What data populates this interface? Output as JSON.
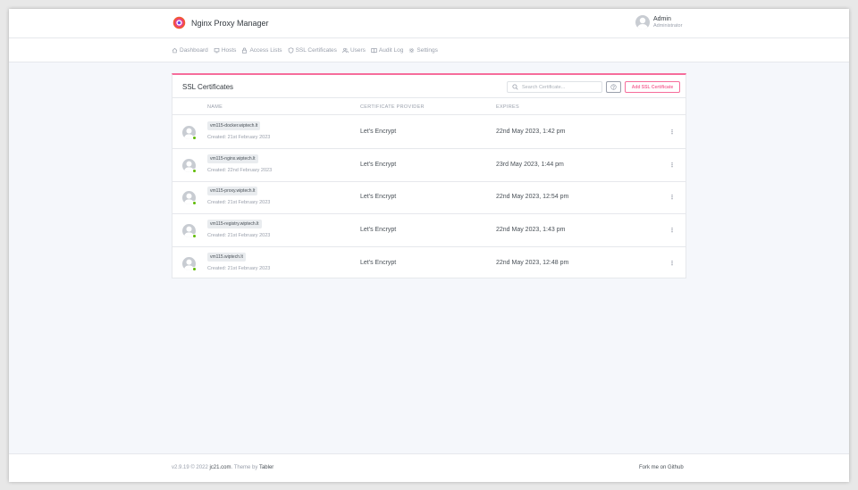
{
  "app": {
    "title": "Nginx Proxy Manager",
    "logo_icon": "nginx-proxy-manager-logo",
    "accent_color": "#f66d9b"
  },
  "user": {
    "name": "Admin",
    "role": "Administrator"
  },
  "nav": {
    "items": [
      {
        "label": "Dashboard",
        "icon": "home-icon"
      },
      {
        "label": "Hosts",
        "icon": "monitor-icon"
      },
      {
        "label": "Access Lists",
        "icon": "lock-icon"
      },
      {
        "label": "SSL Certificates",
        "icon": "shield-icon"
      },
      {
        "label": "Users",
        "icon": "users-icon"
      },
      {
        "label": "Audit Log",
        "icon": "book-icon"
      },
      {
        "label": "Settings",
        "icon": "gear-icon"
      }
    ]
  },
  "card": {
    "title": "SSL Certificates",
    "search_placeholder": "Search Certificate...",
    "add_button": "Add SSL Certificate",
    "columns": {
      "name": "NAME",
      "provider": "CERTIFICATE PROVIDER",
      "expires": "EXPIRES"
    },
    "rows": [
      {
        "domain": "vm115-docker.wiptech.lt",
        "created": "Created: 21st February 2023",
        "provider": "Let's Encrypt",
        "expires": "22nd May 2023, 1:42 pm"
      },
      {
        "domain": "vm115-nginx.wiptech.lt",
        "created": "Created: 22nd February 2023",
        "provider": "Let's Encrypt",
        "expires": "23rd May 2023, 1:44 pm"
      },
      {
        "domain": "vm115-proxy.wiptech.lt",
        "created": "Created: 21st February 2023",
        "provider": "Let's Encrypt",
        "expires": "22nd May 2023, 12:54 pm"
      },
      {
        "domain": "vm115-registry.wiptech.lt",
        "created": "Created: 21st February 2023",
        "provider": "Let's Encrypt",
        "expires": "22nd May 2023, 1:43 pm"
      },
      {
        "domain": "vm115.wiptech.lt",
        "created": "Created: 21st February 2023",
        "provider": "Let's Encrypt",
        "expires": "22nd May 2023, 12:48 pm"
      }
    ]
  },
  "footer": {
    "version": "v2.9.19 © 2022",
    "author_link": "jc21.com",
    "theme_text": ". Theme by",
    "theme_link": "Tabler",
    "fork_link": "Fork me on Github"
  }
}
